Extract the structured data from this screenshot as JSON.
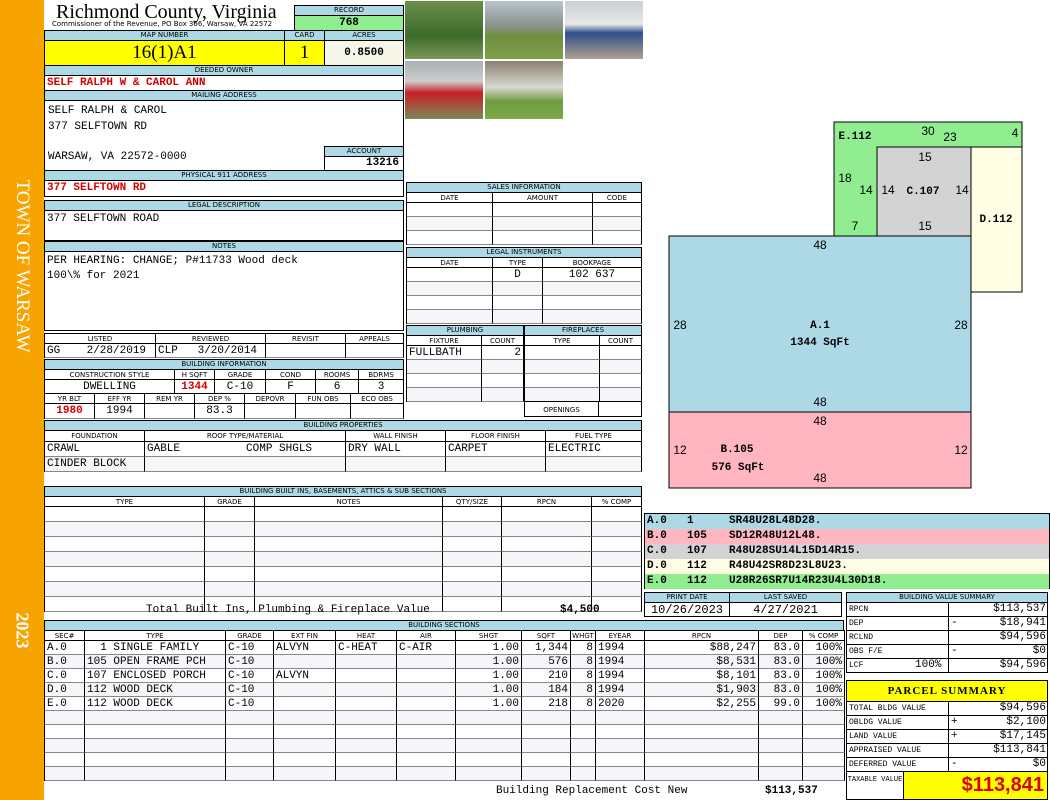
{
  "sidebar": {
    "town": "TOWN OF WARSAW",
    "year": "2023"
  },
  "header": {
    "county": "Richmond County, Virginia",
    "subtitle": "Commissioner of the Revenue, PO Box 366, Warsaw, VA 22572",
    "record_label": "RECORD",
    "record": "768"
  },
  "parcel": {
    "map_label": "MAP NUMBER",
    "map": "16(1)A1",
    "card_label": "CARD",
    "card": "1",
    "acres_label": "ACRES",
    "acres": "0.8500"
  },
  "owner": {
    "label": "DEEDED OWNER",
    "name": "SELF RALPH W & CAROL ANN",
    "mailing_label": "MAILING ADDRESS",
    "mailing": [
      "SELF RALPH & CAROL",
      "377 SELFTOWN RD",
      "WARSAW, VA 22572-0000"
    ],
    "account_label": "ACCOUNT",
    "account": "13216",
    "physical_label": "PHYSICAL 911 ADDRESS",
    "physical": "377 SELFTOWN RD"
  },
  "legal": {
    "label": "LEGAL DESCRIPTION",
    "text": "377 SELFTOWN ROAD"
  },
  "notes": {
    "label": "NOTES",
    "lines": [
      "PER HEARING: CHANGE; P#11733 Wood deck",
      "100\\% for 2021"
    ]
  },
  "listing": {
    "headers": [
      "LISTED",
      "REVIEWED",
      "REVISIT",
      "APPEALS"
    ],
    "rows": [
      [
        "GG    2/28/2019",
        "CLP   3/20/2014",
        "",
        ""
      ]
    ]
  },
  "building_info": {
    "label": "BUILDING INFORMATION",
    "headers1": [
      "CONSTRUCTION STYLE",
      "H SQFT",
      "GRADE",
      "COND",
      "ROOMS",
      "BDRMS"
    ],
    "values1": [
      [
        "DWELLING",
        "1344",
        "C-10",
        "F",
        "6",
        "3"
      ]
    ],
    "headers2": [
      "YR BLT",
      "EFF YR",
      "REM YR",
      "DEP %",
      "DEPOVR",
      "FUN OBS",
      "ECO OBS"
    ],
    "values2": [
      [
        "1980",
        "1994",
        "",
        "83.3",
        "",
        "",
        ""
      ]
    ]
  },
  "photos": [
    "house-front-photo",
    "house-photo",
    "carport-photo",
    "truck-photo",
    "shed-photo"
  ],
  "sales": {
    "label": "SALES INFORMATION",
    "headers": [
      "DATE",
      "AMOUNT",
      "CODE"
    ],
    "rows": [
      [
        "",
        "",
        ""
      ],
      [
        "",
        "",
        ""
      ],
      [
        "",
        "",
        ""
      ]
    ]
  },
  "legal_instruments": {
    "label": "LEGAL INSTRUMENTS",
    "headers": [
      "DATE",
      "TYPE",
      "BOOKPAGE"
    ],
    "rows": [
      [
        "",
        "D",
        "102 637"
      ],
      [
        "",
        "",
        ""
      ],
      [
        "",
        "",
        ""
      ],
      [
        "",
        "",
        ""
      ]
    ]
  },
  "plumbing": {
    "label": "PLUMBING",
    "headers": [
      "FIXTURE",
      "COUNT"
    ],
    "rows": [
      [
        "FULLBATH",
        "2"
      ],
      [
        "",
        ""
      ],
      [
        "",
        ""
      ],
      [
        "",
        ""
      ]
    ]
  },
  "fireplaces": {
    "label": "FIREPLACES",
    "headers": [
      "TYPE",
      "COUNT"
    ],
    "rows": [
      [
        "",
        ""
      ],
      [
        "",
        ""
      ],
      [
        "",
        ""
      ],
      [
        "",
        ""
      ]
    ],
    "openings_label": "OPENINGS",
    "openings": ""
  },
  "building_properties": {
    "label": "BUILDING PROPERTIES",
    "headers": [
      "FOUNDATION",
      "ROOF TYPE/MATERIAL",
      "WALL FINISH",
      "FLOOR FINISH",
      "FUEL TYPE"
    ],
    "rows": [
      [
        "CRAWL",
        "GABLE          COMP SHGLS",
        "DRY WALL",
        "CARPET",
        "ELECTRIC"
      ],
      [
        "CINDER BLOCK",
        "",
        "",
        "",
        ""
      ]
    ]
  },
  "built_ins": {
    "label": "BUILDING BUILT INS, BASEMENTS, ATTICS & SUB SECTIONS",
    "headers": [
      "TYPE",
      "GRADE",
      "NOTES",
      "QTY/SIZE",
      "RPCN",
      "% COMP"
    ],
    "rows": [
      [
        "",
        "",
        "",
        "",
        "",
        ""
      ],
      [
        "",
        "",
        "",
        "",
        "",
        ""
      ],
      [
        "",
        "",
        "",
        "",
        "",
        ""
      ],
      [
        "",
        "",
        "",
        "",
        "",
        ""
      ],
      [
        "",
        "",
        "",
        "",
        "",
        ""
      ],
      [
        "",
        "",
        "",
        "",
        "",
        ""
      ],
      [
        "",
        "",
        "",
        "",
        "",
        ""
      ]
    ],
    "total_label": "Total Built Ins, Plumbing & Fireplace Value",
    "total": "$4,500"
  },
  "building_sections": {
    "label": "BUILDING SECTIONS",
    "headers": [
      "SEC#",
      "TYPE",
      "GRADE",
      "EXT FIN",
      "HEAT",
      "AIR",
      "SHGT",
      "SQFT",
      "WHGT",
      "EYEAR",
      "RPCN",
      "DEP",
      "% COMP"
    ],
    "rows": [
      [
        "A.0",
        "  1 SINGLE FAMILY",
        "C-10",
        "ALVYN",
        "C-HEAT",
        "C-AIR",
        "1.00",
        "1,344",
        "8",
        "1994",
        "$88,247",
        "83.0",
        "100%"
      ],
      [
        "B.0",
        "105 OPEN FRAME PCH",
        "C-10",
        "",
        "",
        "",
        "1.00",
        "576",
        "8",
        "1994",
        "$8,531",
        "83.0",
        "100%"
      ],
      [
        "C.0",
        "107 ENCLOSED PORCH",
        "C-10",
        "ALVYN",
        "",
        "",
        "1.00",
        "210",
        "8",
        "1994",
        "$8,101",
        "83.0",
        "100%"
      ],
      [
        "D.0",
        "112 WOOD DECK",
        "C-10",
        "",
        "",
        "",
        "1.00",
        "184",
        "8",
        "1994",
        "$1,903",
        "83.0",
        "100%"
      ],
      [
        "E.0",
        "112 WOOD DECK",
        "C-10",
        "",
        "",
        "",
        "1.00",
        "218",
        "8",
        "2020",
        "$2,255",
        "99.0",
        "100%"
      ],
      [
        "",
        "",
        "",
        "",
        "",
        "",
        "",
        "",
        "",
        "",
        "",
        "",
        ""
      ],
      [
        "",
        "",
        "",
        "",
        "",
        "",
        "",
        "",
        "",
        "",
        "",
        "",
        ""
      ],
      [
        "",
        "",
        "",
        "",
        "",
        "",
        "",
        "",
        "",
        "",
        "",
        "",
        ""
      ],
      [
        "",
        "",
        "",
        "",
        "",
        "",
        "",
        "",
        "",
        "",
        "",
        "",
        ""
      ],
      [
        "",
        "",
        "",
        "",
        "",
        "",
        "",
        "",
        "",
        "",
        "",
        "",
        ""
      ]
    ],
    "total_label": "Building Replacement Cost New",
    "total": "$113,537"
  },
  "sketch": {
    "labels": [
      "E.112",
      "30",
      "23",
      "4",
      "15",
      "18",
      "14",
      "C.107",
      "14",
      "14",
      "D.112",
      "7",
      "15",
      "48",
      "28",
      "A.1",
      "1344 SqFt",
      "28",
      "48",
      "48",
      "12",
      "B.105",
      "576 SqFt",
      "12",
      "48"
    ],
    "colors": {
      "A": "#add8e6",
      "B": "#ffb6c1",
      "C": "#d3d3d3",
      "D": "#fffde4",
      "E": "#90ee90"
    }
  },
  "sketch_legend": [
    [
      "A.0",
      "1",
      "SR48U28L48D28."
    ],
    [
      "B.0",
      "105",
      "SD12R48U12L48."
    ],
    [
      "C.0",
      "107",
      "R48U28SU14L15D14R15."
    ],
    [
      "D.0",
      "112",
      "R48U42SR8D23L8U23."
    ],
    [
      "E.0",
      "112",
      "U28R26SR7U14R23U4L30D18."
    ]
  ],
  "dates": {
    "print_label": "PRINT DATE",
    "print": "10/26/2023",
    "saved_label": "LAST SAVED",
    "saved": "4/27/2021"
  },
  "value_summary": {
    "label": "BUILDING VALUE SUMMARY",
    "rows": [
      [
        "RPCN",
        "",
        "",
        "$113,537"
      ],
      [
        "DEP",
        "",
        "-",
        "$18,941"
      ],
      [
        "RCLND",
        "",
        "",
        "$94,596"
      ],
      [
        "OBS F/E",
        "",
        "-",
        "$0"
      ],
      [
        "LCF",
        "100%",
        "",
        "$94,596"
      ]
    ]
  },
  "parcel_summary": {
    "label": "PARCEL SUMMARY",
    "rows": [
      [
        "TOTAL BLDG VALUE",
        "",
        "$94,596"
      ],
      [
        "OBLDG VALUE",
        "+",
        "$2,100"
      ],
      [
        "LAND VALUE",
        "+",
        "$17,145"
      ],
      [
        "APPRAISED VALUE",
        "",
        "$113,841"
      ],
      [
        "DEFERRED VALUE",
        "-",
        "$0"
      ]
    ],
    "taxable_label": "TAXABLE VALUE",
    "taxable": "$113,841"
  }
}
